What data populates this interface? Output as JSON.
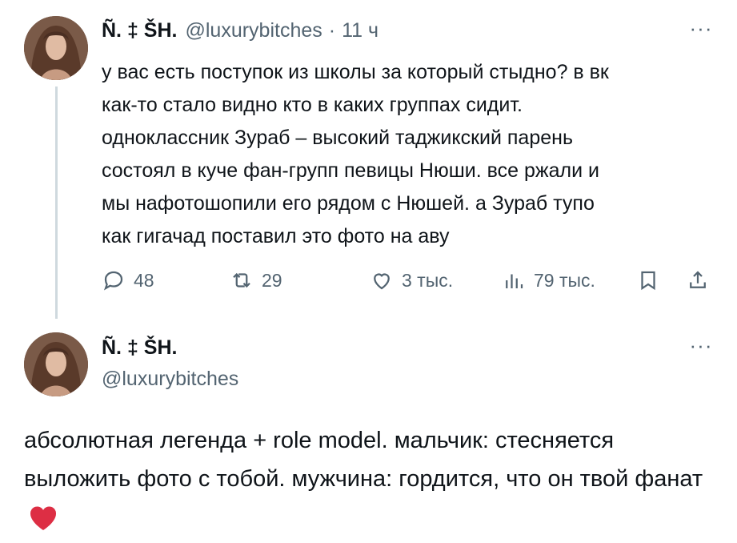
{
  "colors": {
    "text": "#0f1419",
    "secondary": "#536471",
    "thread_line": "#cfd9de",
    "heart": "#e0245e"
  },
  "tweet1": {
    "display_name": "Ñ. ‡ ŠH.",
    "handle": "@luxurybitches",
    "separator": "·",
    "time": "11 ч",
    "more": "···",
    "text": "у вас есть поступок из школы за который стыдно? в вк\nкак-то стало видно кто в каких группах сидит.\nодноклассник Зураб – высокий таджикский парень\nсостоял в куче фан-групп певицы Нюши. все ржали и\nмы нафотошопили его рядом с Нюшей. а Зураб тупо\nкак гигачад поставил это фото на аву",
    "actions": {
      "replies": "48",
      "reposts": "29",
      "likes": "3 тыс.",
      "views": "79 тыс."
    },
    "icons": [
      "reply-icon",
      "repost-icon",
      "like-icon",
      "views-icon",
      "bookmark-icon",
      "share-icon"
    ]
  },
  "tweet2": {
    "display_name": "Ñ. ‡ ŠH.",
    "handle": "@luxurybitches",
    "more": "···",
    "text": "абсолютная легенда + role model. мальчик: стесняется выложить фото с тобой. мужчина: гордится, что он твой фанат",
    "emoji": "red-heart-icon"
  }
}
